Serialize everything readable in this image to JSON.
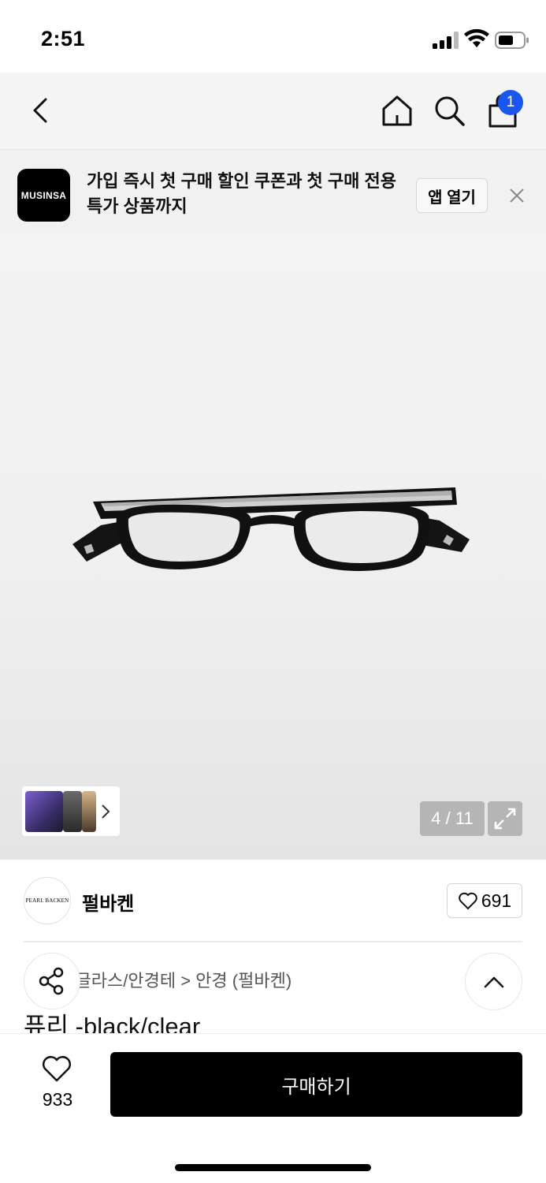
{
  "status_bar": {
    "time": "2:51"
  },
  "nav": {
    "cart_count": "1"
  },
  "banner": {
    "logo_text": "MUSINSA",
    "message": "가입 즉시 첫 구매 할인 쿠폰과 첫 구매 전용 특가 상품까지",
    "open_label": "앱 열기"
  },
  "gallery": {
    "pager": "4 / 11"
  },
  "brand": {
    "logo_text": "PEARL BACKEN",
    "name": "펄바켄",
    "likes": "691"
  },
  "product": {
    "breadcrumb": "품 > 선글라스/안경테 > 안경 (펄바켄)",
    "title": "퓨리 -black/clear"
  },
  "bottom_bar": {
    "like_count": "933",
    "buy_label": "구매하기"
  },
  "colors": {
    "badge": "#1a56f0",
    "buy_button": "#000000"
  }
}
